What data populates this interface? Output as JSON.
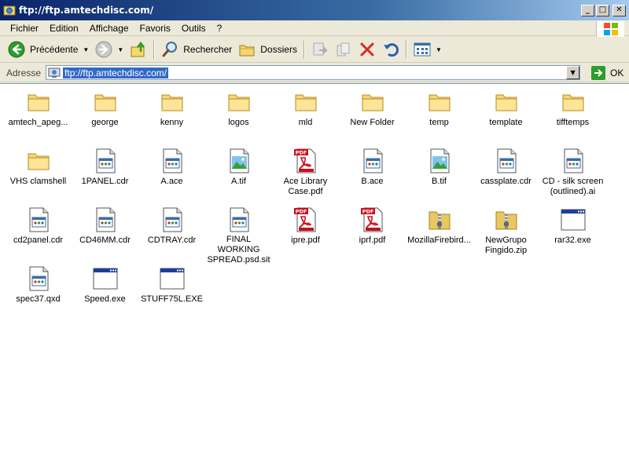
{
  "window": {
    "title": "ftp://ftp.amtechdisc.com/"
  },
  "menu": [
    "Fichier",
    "Edition",
    "Affichage",
    "Favoris",
    "Outils",
    "?"
  ],
  "toolbar": {
    "back_label": "Précédente",
    "search_label": "Rechercher",
    "folders_label": "Dossiers"
  },
  "address": {
    "label": "Adresse",
    "value": "ftp://ftp.amtechdisc.com/",
    "go_label": "OK"
  },
  "files": [
    {
      "name": "amtech_apeg...",
      "type": "folder"
    },
    {
      "name": "george",
      "type": "folder"
    },
    {
      "name": "kenny",
      "type": "folder"
    },
    {
      "name": "logos",
      "type": "folder"
    },
    {
      "name": "mld",
      "type": "folder"
    },
    {
      "name": "New Folder",
      "type": "folder"
    },
    {
      "name": "temp",
      "type": "folder"
    },
    {
      "name": "template",
      "type": "folder"
    },
    {
      "name": "tifftemps",
      "type": "folder"
    },
    {
      "name": "VHS clamshell",
      "type": "folder"
    },
    {
      "name": "1PANEL.cdr",
      "type": "doc"
    },
    {
      "name": "A.ace",
      "type": "doc"
    },
    {
      "name": "A.tif",
      "type": "image"
    },
    {
      "name": "Ace Library Case.pdf",
      "type": "pdf"
    },
    {
      "name": "B.ace",
      "type": "doc"
    },
    {
      "name": "B.tif",
      "type": "image"
    },
    {
      "name": "cassplate.cdr",
      "type": "doc"
    },
    {
      "name": "CD - silk screen (outlined).ai",
      "type": "doc"
    },
    {
      "name": "cd2panel.cdr",
      "type": "doc"
    },
    {
      "name": "CD46MM.cdr",
      "type": "doc"
    },
    {
      "name": "CDTRAY.cdr",
      "type": "doc"
    },
    {
      "name": "FINAL WORKING SPREAD.psd.sit",
      "type": "doc"
    },
    {
      "name": "ipre.pdf",
      "type": "pdf"
    },
    {
      "name": "iprf.pdf",
      "type": "pdf"
    },
    {
      "name": "MozillaFirebird...",
      "type": "zip"
    },
    {
      "name": "NewGrupo Fingido.zip",
      "type": "zip"
    },
    {
      "name": "rar32.exe",
      "type": "exe"
    },
    {
      "name": "spec37.qxd",
      "type": "doc"
    },
    {
      "name": "Speed.exe",
      "type": "exe"
    },
    {
      "name": "STUFF75L.EXE",
      "type": "exe"
    }
  ],
  "icons": {
    "folder": "folder-icon",
    "doc": "document-icon",
    "image": "image-file-icon",
    "pdf": "pdf-file-icon",
    "zip": "zip-folder-icon",
    "exe": "application-icon"
  }
}
